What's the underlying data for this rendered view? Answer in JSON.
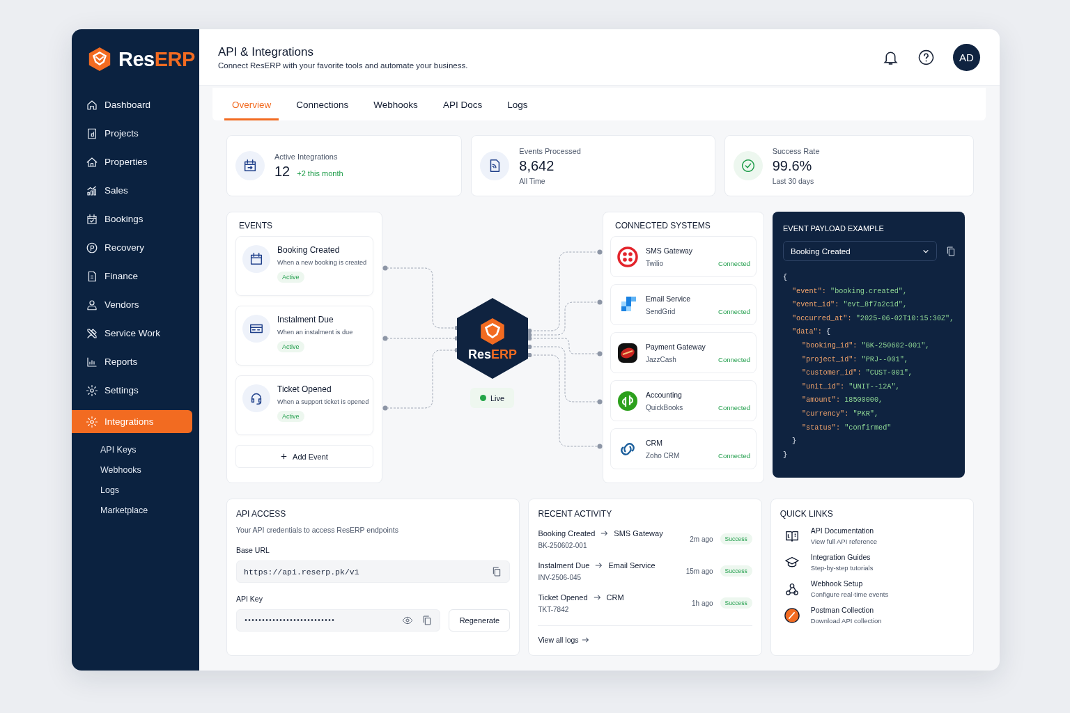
{
  "brand": {
    "part_a": "Res",
    "part_b": "ERP"
  },
  "sidebar": {
    "items": [
      {
        "label": "Dashboard",
        "selected": false
      },
      {
        "label": "Projects",
        "selected": false
      },
      {
        "label": "Properties",
        "selected": false
      },
      {
        "label": "Sales",
        "selected": false
      },
      {
        "label": "Bookings",
        "selected": false
      },
      {
        "label": "Recovery",
        "selected": false
      },
      {
        "label": "Finance",
        "selected": false
      },
      {
        "label": "Vendors",
        "selected": false
      },
      {
        "label": "Service Work",
        "selected": false
      },
      {
        "label": "Reports",
        "selected": false
      },
      {
        "label": "Settings",
        "selected": false
      },
      {
        "label": "Integrations",
        "selected": true,
        "children": [
          {
            "label": "API Keys",
            "selected": false
          },
          {
            "label": "Webhooks",
            "selected": false
          },
          {
            "label": "Logs",
            "selected": false
          },
          {
            "label": "Marketplace",
            "selected": false
          }
        ]
      }
    ]
  },
  "header": {
    "title": "API & Integrations",
    "subtitle": "Connect ResERP with your favorite tools and automate your business.",
    "avatar": "AD"
  },
  "tabs": [
    {
      "label": "Overview",
      "selected": true
    },
    {
      "label": "Connections",
      "selected": false
    },
    {
      "label": "Webhooks",
      "selected": false
    },
    {
      "label": "API Docs",
      "selected": false
    },
    {
      "label": "Logs",
      "selected": false
    }
  ],
  "stats": [
    {
      "label": "Active Integrations",
      "value": "12",
      "delta": "+2 this month"
    },
    {
      "label": "Events Processed",
      "value": "8,642",
      "note": "All Time"
    },
    {
      "label": "Success Rate",
      "value": "99.6%",
      "note": "Last 30 days"
    }
  ],
  "events": {
    "title": "EVENTS",
    "items": [
      {
        "title": "Booking Created",
        "description": "When a new booking is created",
        "status": "Active"
      },
      {
        "title": "Instalment Due",
        "description": "When an instalment is due",
        "status": "Active"
      },
      {
        "title": "Ticket Opened",
        "description": "When a support ticket is opened",
        "status": "Active"
      }
    ],
    "add_button": "Add Event"
  },
  "hub": {
    "part_a": "Res",
    "part_b": "ERP",
    "status": "Live"
  },
  "connected": {
    "title": "CONNECTED SYSTEMS",
    "items": [
      {
        "name": "SMS Gateway",
        "provider": "Twilio",
        "status": "Connected"
      },
      {
        "name": "Email Service",
        "provider": "SendGrid",
        "status": "Connected"
      },
      {
        "name": "Payment Gateway",
        "provider": "JazzCash",
        "status": "Connected"
      },
      {
        "name": "Accounting",
        "provider": "QuickBooks",
        "status": "Connected"
      },
      {
        "name": "CRM",
        "provider": "Zoho CRM",
        "status": "Connected"
      }
    ]
  },
  "payload": {
    "title": "EVENT PAYLOAD EXAMPLE",
    "selected_event": "Booking Created",
    "open": "{",
    "close": "}",
    "entries": [
      {
        "key": "\"event\":",
        "value": "\"booking.created\","
      },
      {
        "key": "\"event_id\":",
        "value": "\"evt_8f7a2c1d\","
      },
      {
        "key": "\"occurred_at\":",
        "value": "\"2025-06-02T10:15:30Z\","
      },
      {
        "key": "\"data\":",
        "open": "{",
        "close": "}",
        "entries": [
          {
            "key": "\"booking_id\":",
            "value": "\"BK-250602-001\","
          },
          {
            "key": "\"project_id\":",
            "value": "\"PRJ-‑001\","
          },
          {
            "key": "\"customer_id\":",
            "value": "\"CUST-001\","
          },
          {
            "key": "\"unit_id\":",
            "value": "\"UNIT--12A\","
          },
          {
            "key": "\"amount\":",
            "value": "18500000,"
          },
          {
            "key": "\"currency\":",
            "value": "\"PKR\","
          },
          {
            "key": "\"status\":",
            "value": "\"confirmed\""
          }
        ]
      }
    ]
  },
  "api_access": {
    "title": "API ACCESS",
    "description": "Your API credentials to access ResERP endpoints",
    "base_url_label": "Base URL",
    "base_url": "https://api.reserp.pk/v1",
    "api_key_label": "API Key",
    "api_key": "••••••••••••••••••••••••••",
    "regenerate": "Regenerate"
  },
  "recent_activity": {
    "title": "RECENT ACTIVITY",
    "items": [
      {
        "event": "Booking Created",
        "target": "SMS Gateway",
        "ref": "BK-250602-001",
        "time": "2m ago",
        "status": "Success"
      },
      {
        "event": "Instalment Due",
        "target": "Email Service",
        "ref": "INV-2506-045",
        "time": "15m ago",
        "status": "Success"
      },
      {
        "event": "Ticket Opened",
        "target": "CRM",
        "ref": "TKT-7842",
        "time": "1h ago",
        "status": "Success"
      }
    ],
    "view_all": "View all logs"
  },
  "quick_links": {
    "title": "QUICK LINKS",
    "items": [
      {
        "title": "API Documentation",
        "subtitle": "View full API reference"
      },
      {
        "title": "Integration Guides",
        "subtitle": "Step-by-step tutorials"
      },
      {
        "title": "Webhook Setup",
        "subtitle": "Configure real-time events"
      },
      {
        "title": "Postman Collection",
        "subtitle": "Download API collection"
      }
    ]
  }
}
